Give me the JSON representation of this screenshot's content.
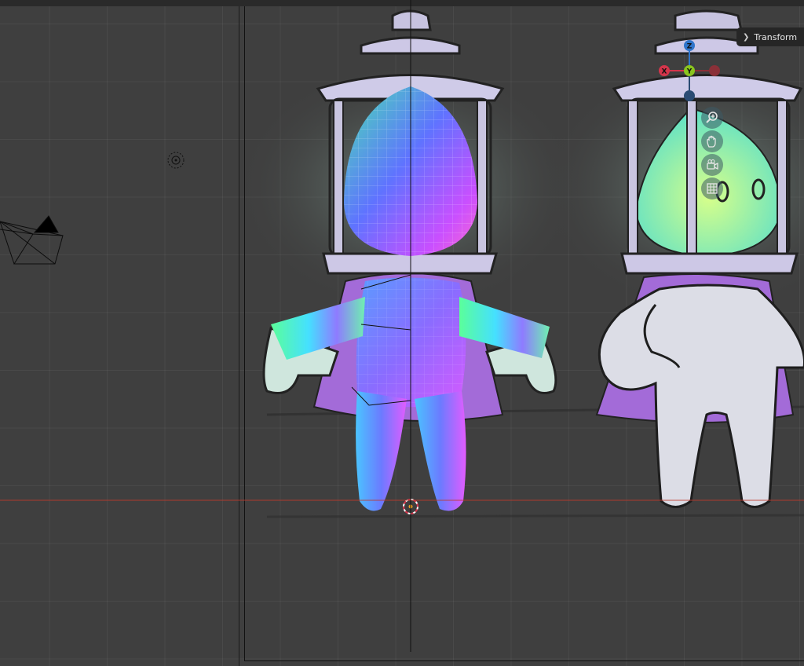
{
  "viewport": {
    "sidebar_toggle_label": "Transform",
    "gizmo_axes": {
      "x_label": "X",
      "y_label": "Y",
      "z_label": "Z"
    },
    "nav_tools": [
      {
        "name": "zoom-icon"
      },
      {
        "name": "pan-hand-icon"
      },
      {
        "name": "camera-view-icon"
      },
      {
        "name": "ortho-grid-icon"
      }
    ]
  },
  "colors": {
    "axis_x": "#d4354b",
    "axis_y": "#8ac51e",
    "axis_z": "#2f74c9",
    "background": "#3f3f3f",
    "ghost_body": "#dcdde6",
    "outline": "#1e1e1e"
  }
}
